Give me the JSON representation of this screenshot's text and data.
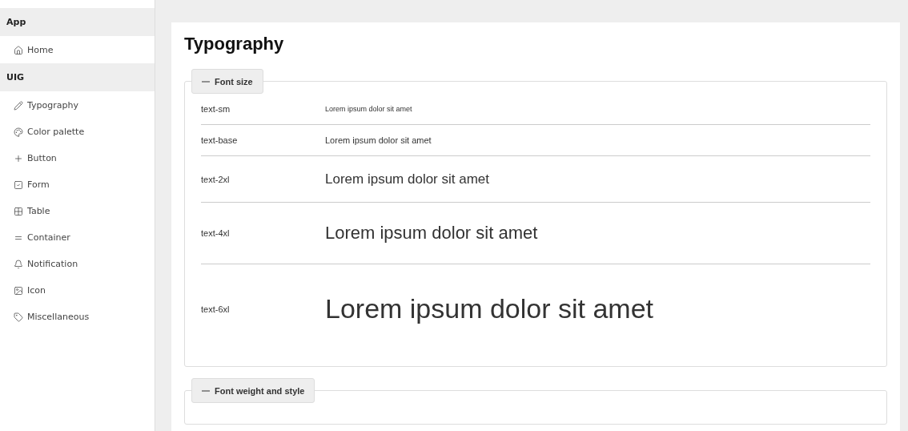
{
  "sidebar": {
    "groups": [
      {
        "title": "App",
        "items": [
          {
            "label": "Home"
          }
        ]
      },
      {
        "title": "UIG",
        "items": [
          {
            "label": "Typography"
          },
          {
            "label": "Color palette"
          },
          {
            "label": "Button"
          },
          {
            "label": "Form"
          },
          {
            "label": "Table"
          },
          {
            "label": "Container"
          },
          {
            "label": "Notification"
          },
          {
            "label": "Icon"
          },
          {
            "label": "Miscellaneous"
          }
        ]
      }
    ]
  },
  "page": {
    "title": "Typography",
    "sections": [
      {
        "legend": "Font size",
        "expanded": true,
        "rows": [
          {
            "name": "text-sm",
            "sample": "Lorem ipsum dolor sit amet"
          },
          {
            "name": "text-base",
            "sample": "Lorem ipsum dolor sit amet"
          },
          {
            "name": "text-2xl",
            "sample": "Lorem ipsum dolor sit amet"
          },
          {
            "name": "text-4xl",
            "sample": "Lorem ipsum dolor sit amet"
          },
          {
            "name": "text-6xl",
            "sample": "Lorem ipsum dolor sit amet"
          }
        ]
      },
      {
        "legend": "Font weight and style",
        "expanded": true
      }
    ]
  }
}
